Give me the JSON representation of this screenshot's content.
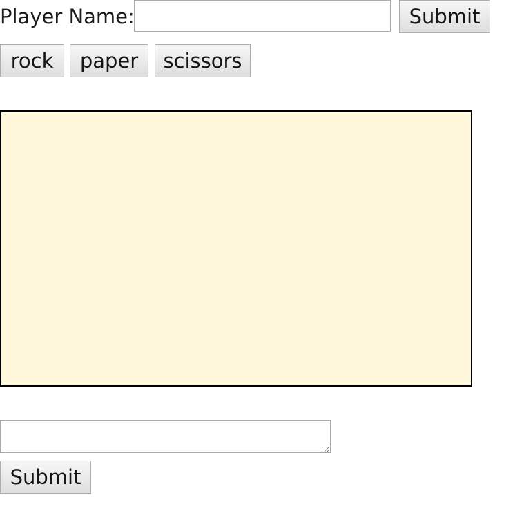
{
  "player": {
    "label": "Player Name:",
    "name_value": "",
    "submit_label": "Submit"
  },
  "choices": {
    "rock": "rock",
    "paper": "paper",
    "scissors": "scissors"
  },
  "game_area": {
    "background": "#fff8dc",
    "border_color": "#000000"
  },
  "message": {
    "value": "",
    "submit_label": "Submit"
  }
}
